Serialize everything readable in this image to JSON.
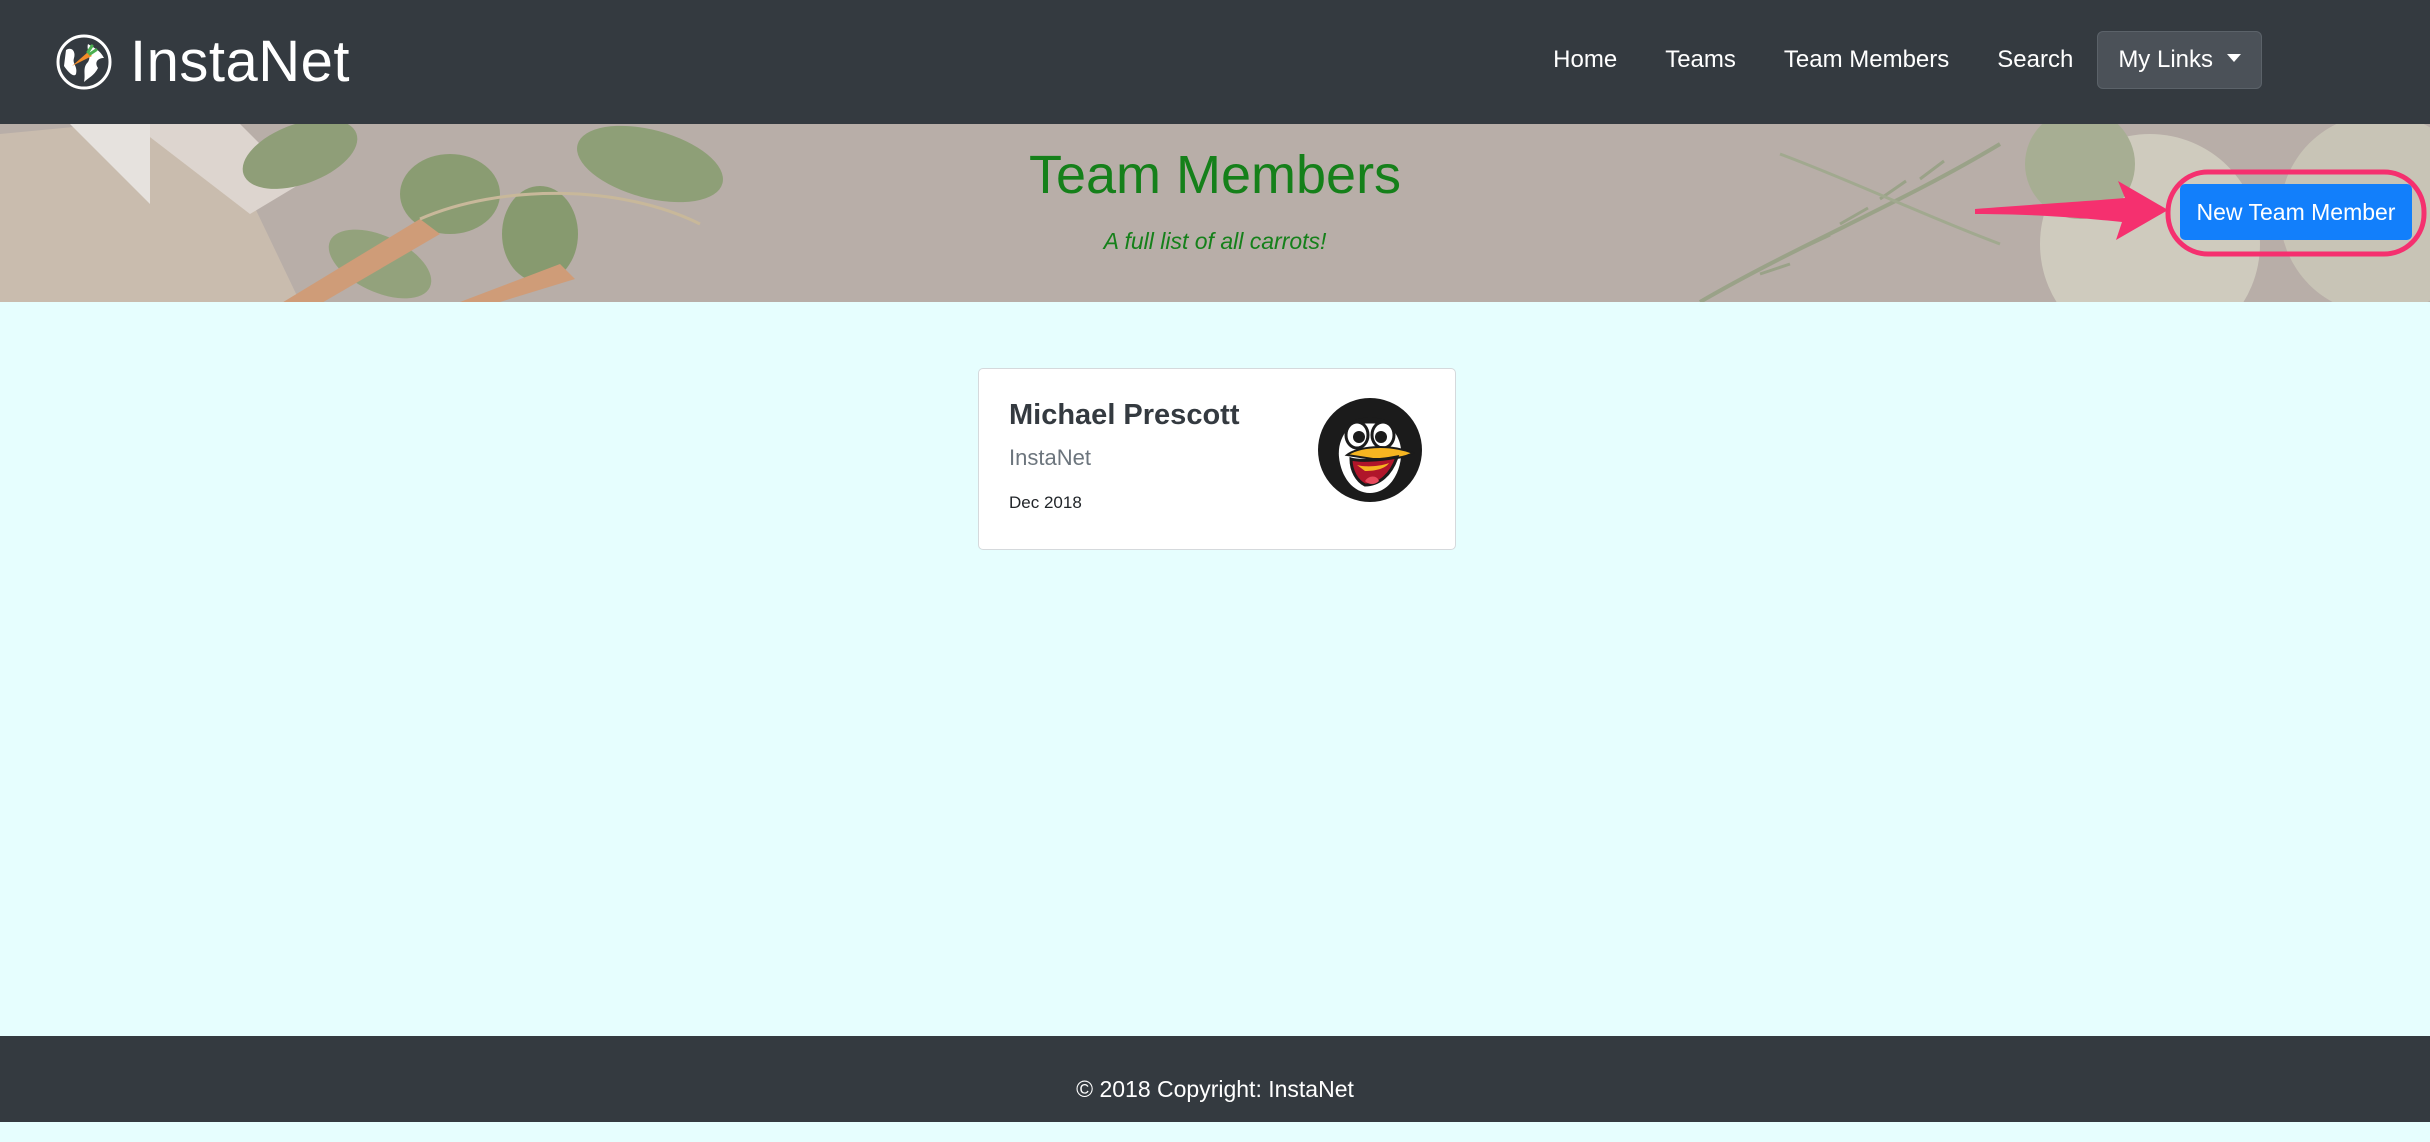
{
  "navbar": {
    "brand": "InstaNet",
    "brand_icon": "globe-carrot-logo-icon",
    "links": [
      "Home",
      "Teams",
      "Team Members",
      "Search"
    ],
    "dropdown_label": "My Links"
  },
  "hero": {
    "title": "Team Members",
    "subtitle": "A full list of all carrots!",
    "action_button": "New Team Member"
  },
  "members": [
    {
      "name": "Michael Prescott",
      "team": "InstaNet",
      "date": "Dec 2018",
      "avatar_icon": "penguin-avatar-icon"
    }
  ],
  "footer": {
    "copyright": "© 2018 Copyright: InstaNet"
  },
  "colors": {
    "navbar": "#343a40",
    "page_background": "#e6fefe",
    "accent_green": "#15801a",
    "button_blue": "#127ffb",
    "annotation_pink": "#f5306f"
  }
}
